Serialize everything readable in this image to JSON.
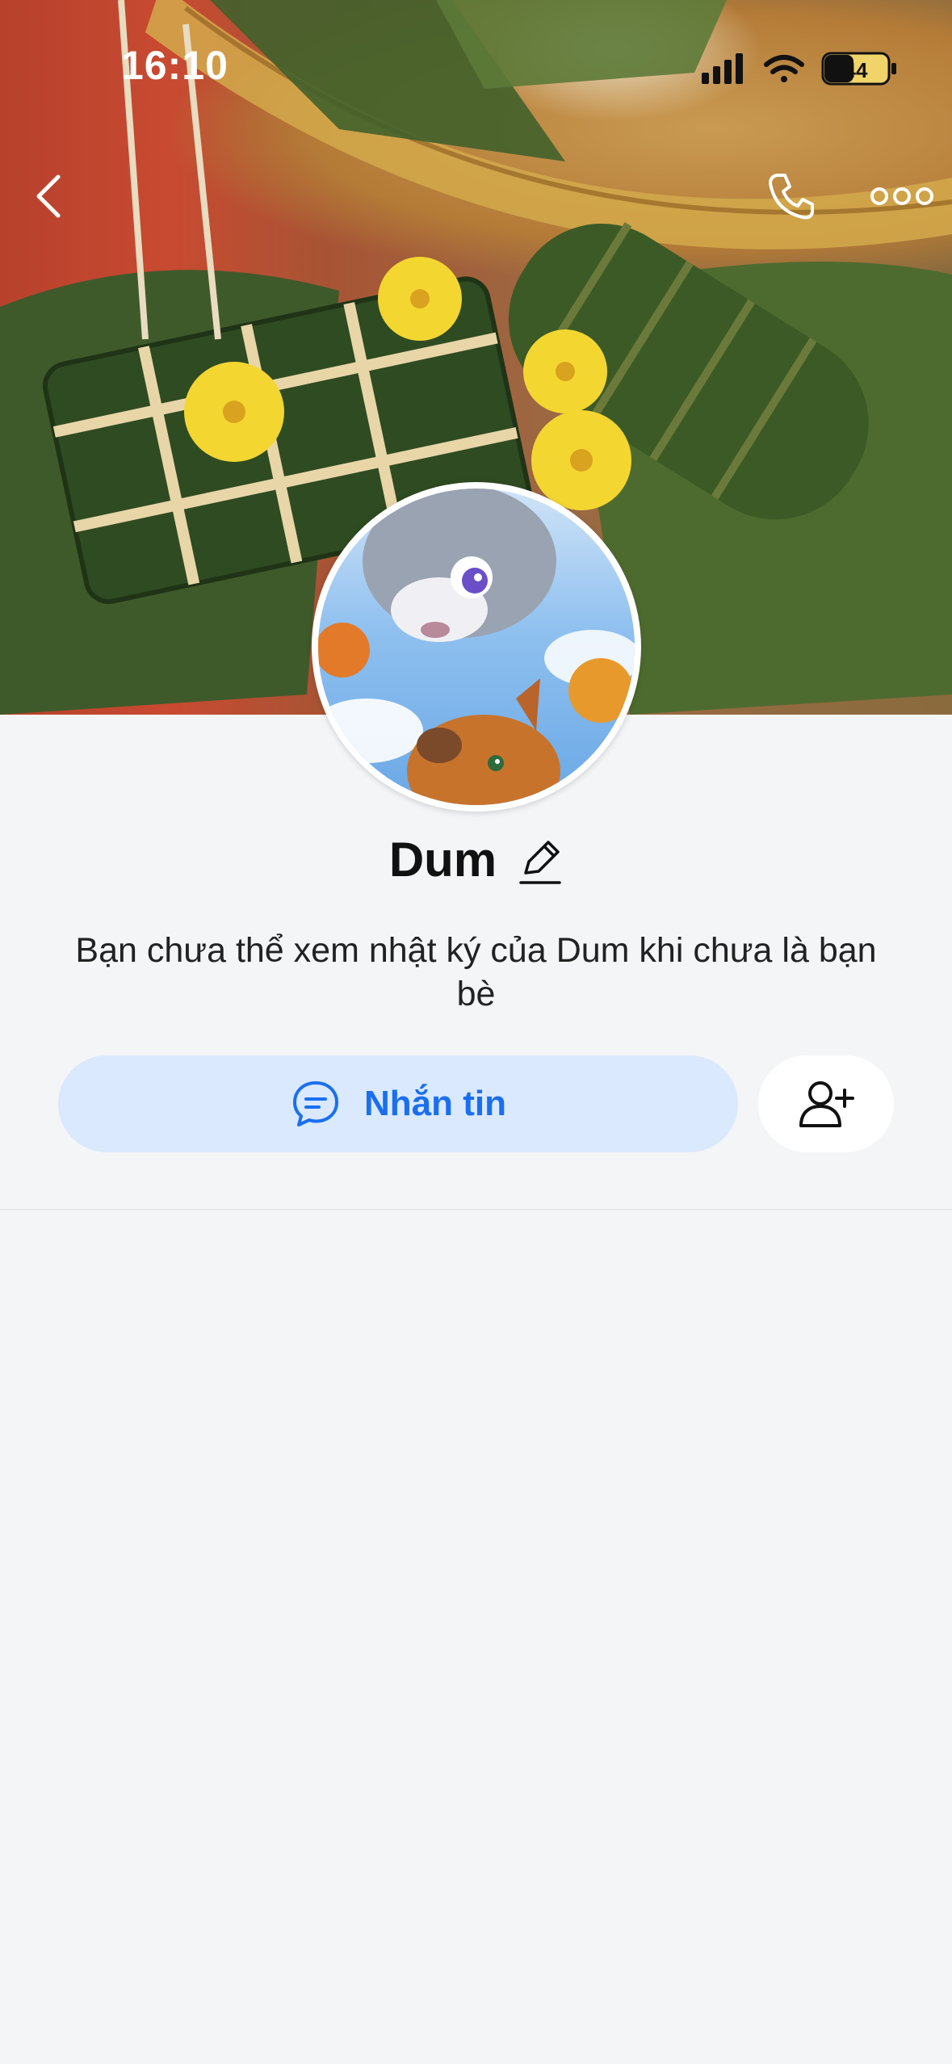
{
  "status_bar": {
    "time": "16:10",
    "battery": "44",
    "icons": [
      "signal-icon",
      "wifi-icon",
      "battery-icon"
    ]
  },
  "header": {
    "back_icon": "chevron-left-icon",
    "call_icon": "phone-icon",
    "more_icon": "more-horizontal-icon"
  },
  "profile": {
    "name": "Dum",
    "edit_icon": "pencil-icon",
    "subtitle": "Bạn chưa thể xem nhật ký của Dum khi chưa là bạn bè"
  },
  "actions": {
    "message_label": "Nhắn tin",
    "message_icon": "chat-bubble-icon",
    "add_friend_icon": "user-plus-icon"
  },
  "colors": {
    "accent": "#1a6ff0",
    "message_button_bg": "#dae9fd",
    "page_bg": "#f4f5f7"
  }
}
